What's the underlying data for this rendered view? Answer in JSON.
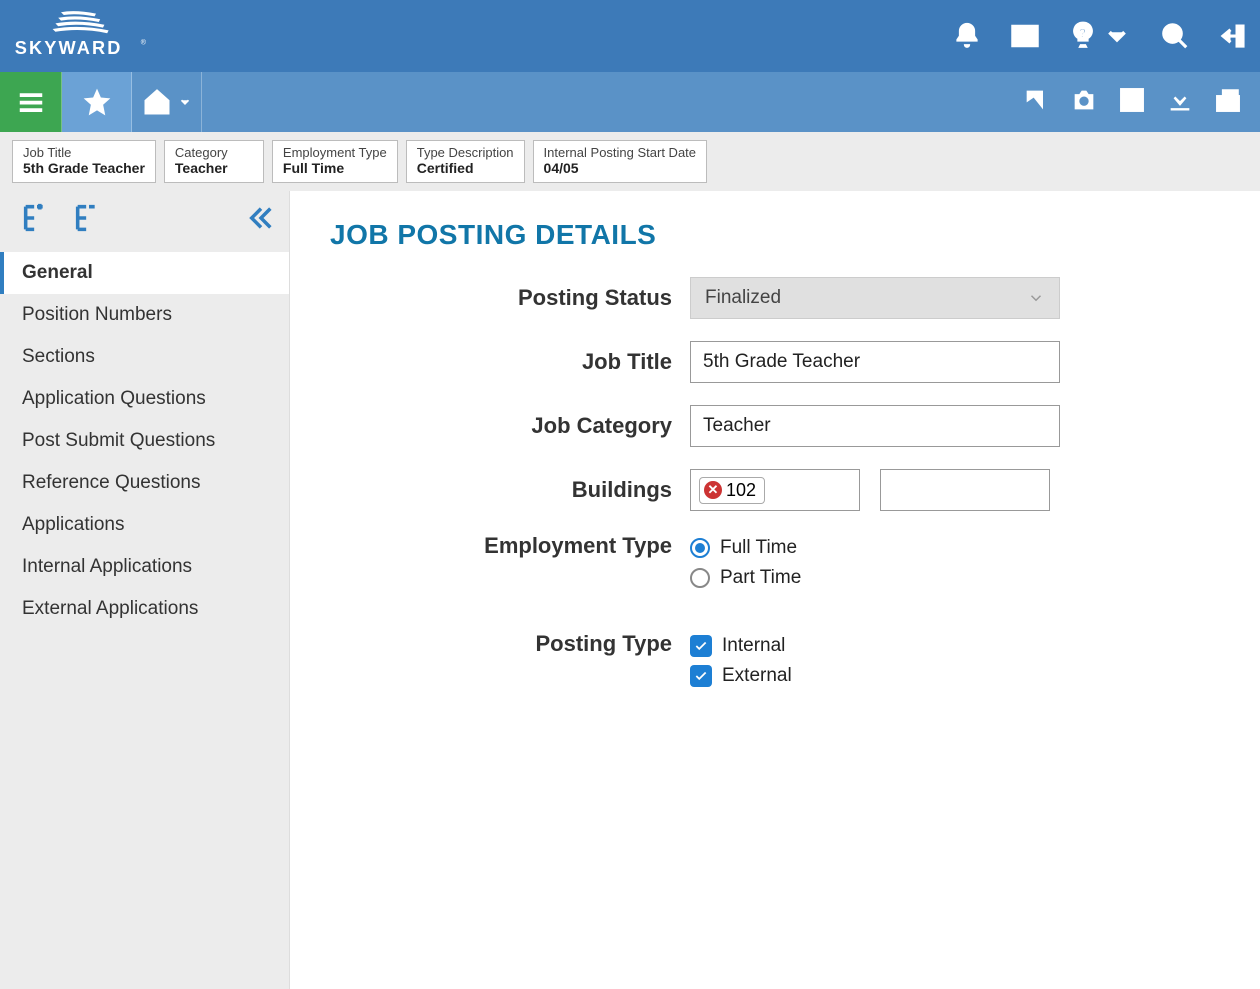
{
  "brand": "SKYWARD",
  "breadcrumbs": [
    {
      "label": "Job Title",
      "value": "5th Grade Teacher"
    },
    {
      "label": "Category",
      "value": "Teacher"
    },
    {
      "label": "Employment Type",
      "value": "Full Time"
    },
    {
      "label": "Type Description",
      "value": "Certified"
    },
    {
      "label": "Internal Posting Start Date",
      "value": "04/05"
    }
  ],
  "sidebar": {
    "items": [
      "General",
      "Position Numbers",
      "Sections",
      "Application Questions",
      "Post Submit Questions",
      "Reference Questions",
      "Applications",
      "Internal Applications",
      "External Applications"
    ],
    "active_index": 0
  },
  "page": {
    "title": "JOB POSTING DETAILS"
  },
  "form": {
    "posting_status": {
      "label": "Posting Status",
      "value": "Finalized"
    },
    "job_title": {
      "label": "Job Title",
      "value": "5th Grade Teacher"
    },
    "job_category": {
      "label": "Job Category",
      "value": "Teacher"
    },
    "buildings": {
      "label": "Buildings",
      "chip": "102"
    },
    "employment_type": {
      "label": "Employment Type",
      "options": [
        "Full Time",
        "Part Time"
      ],
      "selected": "Full Time"
    },
    "posting_type": {
      "label": "Posting Type",
      "options": [
        {
          "label": "Internal",
          "checked": true
        },
        {
          "label": "External",
          "checked": true
        }
      ]
    }
  }
}
